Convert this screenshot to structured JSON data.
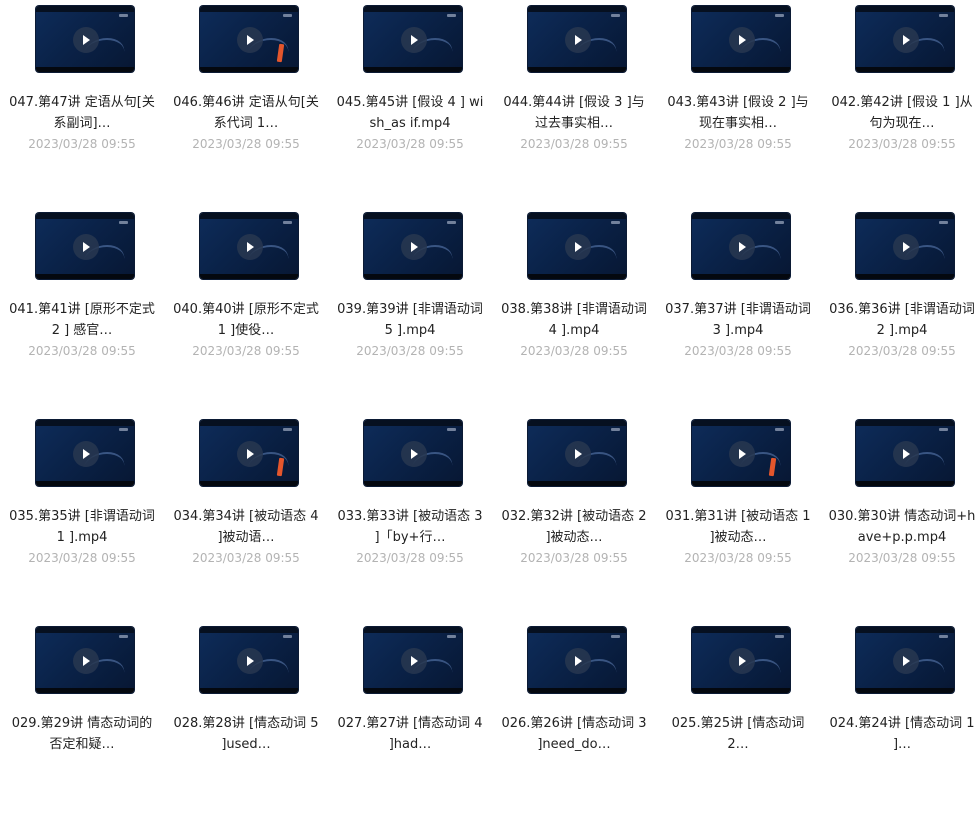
{
  "files": [
    {
      "name": "047.第47讲 定语从句[关系副词]…",
      "date": "2023/03/28 09:55",
      "bar": false
    },
    {
      "name": "046.第46讲 定语从句[关系代词 1…",
      "date": "2023/03/28 09:55",
      "bar": true
    },
    {
      "name": "045.第45讲 [假设 4 ] wish_as if.mp4",
      "date": "2023/03/28 09:55",
      "bar": false
    },
    {
      "name": "044.第44讲 [假设 3 ]与过去事实相…",
      "date": "2023/03/28 09:55",
      "bar": false
    },
    {
      "name": "043.第43讲 [假设 2 ]与现在事实相…",
      "date": "2023/03/28 09:55",
      "bar": false
    },
    {
      "name": "042.第42讲 [假设 1 ]从句为现在…",
      "date": "2023/03/28 09:55",
      "bar": false
    },
    {
      "name": "041.第41讲 [原形不定式 2 ] 感官…",
      "date": "2023/03/28 09:55",
      "bar": false
    },
    {
      "name": "040.第40讲 [原形不定式 1 ]使役…",
      "date": "2023/03/28 09:55",
      "bar": false
    },
    {
      "name": "039.第39讲 [非谓语动词 5 ].mp4",
      "date": "2023/03/28 09:55",
      "bar": false
    },
    {
      "name": "038.第38讲 [非谓语动词 4 ].mp4",
      "date": "2023/03/28 09:55",
      "bar": false
    },
    {
      "name": "037.第37讲 [非谓语动词 3 ].mp4",
      "date": "2023/03/28 09:55",
      "bar": false
    },
    {
      "name": "036.第36讲 [非谓语动词 2 ].mp4",
      "date": "2023/03/28 09:55",
      "bar": false
    },
    {
      "name": "035.第35讲 [非谓语动词 1 ].mp4",
      "date": "2023/03/28 09:55",
      "bar": false
    },
    {
      "name": "034.第34讲 [被动语态 4 ]被动语…",
      "date": "2023/03/28 09:55",
      "bar": true
    },
    {
      "name": "033.第33讲 [被动语态 3 ]「by+行…",
      "date": "2023/03/28 09:55",
      "bar": false
    },
    {
      "name": "032.第32讲 [被动语态 2 ]被动态…",
      "date": "2023/03/28 09:55",
      "bar": false
    },
    {
      "name": "031.第31讲 [被动语态 1 ]被动态…",
      "date": "2023/03/28 09:55",
      "bar": true
    },
    {
      "name": "030.第30讲 情态动词+have+p.p.mp4",
      "date": "2023/03/28 09:55",
      "bar": false
    },
    {
      "name": "029.第29讲 情态动词的否定和疑…",
      "date": "",
      "bar": false
    },
    {
      "name": "028.第28讲 [情态动词 5 ]used…",
      "date": "",
      "bar": false
    },
    {
      "name": "027.第27讲 [情态动词 4 ]had…",
      "date": "",
      "bar": false
    },
    {
      "name": "026.第26讲 [情态动词 3 ]need_do…",
      "date": "",
      "bar": false
    },
    {
      "name": "025.第25讲 [情态动词 2…",
      "date": "",
      "bar": false
    },
    {
      "name": "024.第24讲 [情态动词 1 ]…",
      "date": "",
      "bar": false
    }
  ]
}
